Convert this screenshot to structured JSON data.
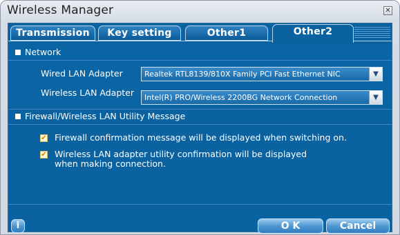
{
  "window": {
    "title": "Wireless Manager",
    "close_glyph": "✕"
  },
  "tabs": [
    {
      "label": "Transmission",
      "active": false
    },
    {
      "label": "Key setting",
      "active": false
    },
    {
      "label": "Other1",
      "active": false
    },
    {
      "label": "Other2",
      "active": true
    }
  ],
  "network": {
    "heading": "Network",
    "wired_label": "Wired LAN Adapter",
    "wired_value": "Realtek RTL8139/810X Family PCI Fast Ethernet NIC",
    "wireless_label": "Wireless LAN Adapter",
    "wireless_value": "Intel(R) PRO/Wireless 2200BG Network Connection"
  },
  "firewall": {
    "heading": "Firewall/Wireless LAN Utility Message",
    "option1": {
      "label": "Firewall confirmation message will be displayed when switching on.",
      "checked": true
    },
    "option2": {
      "label_line1": "Wireless LAN adapter utility confirmation will be displayed",
      "label_line2": "when making connection.",
      "checked": true
    }
  },
  "footer": {
    "info_label": "i",
    "ok_label": "O K",
    "cancel_label": "Cancel"
  },
  "icons": {
    "checkbox_check": "✔",
    "dropdown_arrow": "▼"
  },
  "colors": {
    "panel": "#0a62a0",
    "accent": "#2f7ec0",
    "check": "#d07a00"
  }
}
